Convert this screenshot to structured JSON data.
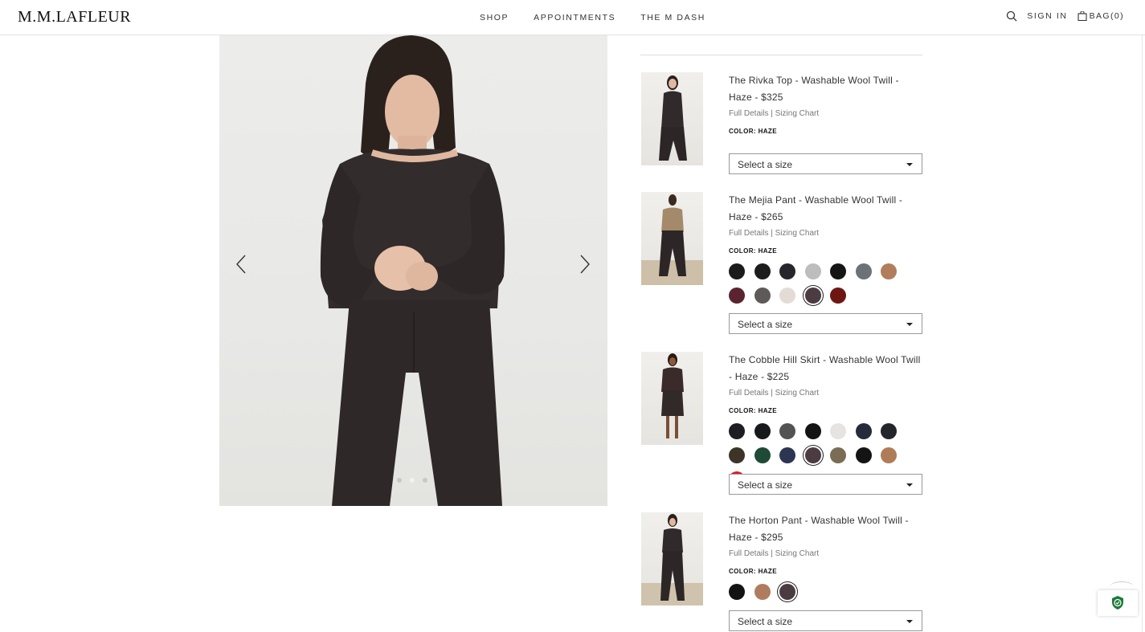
{
  "header": {
    "logo": "M.M.LAFLEUR",
    "nav": [
      "SHOP",
      "APPOINTMENTS",
      "THE M DASH"
    ],
    "sign_in": "SIGN IN",
    "bag": "BAG(0)"
  },
  "carousel": {
    "prev_icon": "chevron-left-icon",
    "next_icon": "chevron-right-icon",
    "total_slides": 3,
    "active_slide": 2
  },
  "products": [
    {
      "title": "The Rivka Top - Washable Wool Twill - Haze - $325",
      "link_full": "Full Details",
      "link_sep": "|",
      "link_sizing": "Sizing Chart",
      "color_label": "COLOR: HAZE",
      "swatches": [],
      "selected_swatch": -1,
      "size_placeholder": "Select a size"
    },
    {
      "title": "The Mejia Pant - Washable Wool Twill - Haze - $265",
      "link_full": "Full Details",
      "link_sep": "|",
      "link_sizing": "Sizing Chart",
      "color_label": "COLOR: HAZE",
      "swatches": [
        "#1b1b1d",
        "#1c1c1e",
        "#25272c",
        "#bdbdbf",
        "#151515",
        "#6e7179",
        "#b27d5b",
        "#5b2330",
        "#5e5a5a",
        "#e3dcd6",
        "#4a3c40",
        "#6e1712"
      ],
      "selected_swatch": 10,
      "size_placeholder": "Select a size"
    },
    {
      "title": "The Cobble Hill Skirt - Washable Wool Twill - Haze - $225",
      "link_full": "Full Details",
      "link_sep": "|",
      "link_sizing": "Sizing Chart",
      "color_label": "COLOR: HAZE",
      "swatches": [
        "#1d1e22",
        "#18191b",
        "#545353",
        "#141414",
        "#e6e4e2",
        "#262a3a",
        "#23252b",
        "#3b3427",
        "#1e4a37",
        "#2c3653",
        "#4a3c40",
        "#7a6c55",
        "#141414",
        "#b07c58",
        "#e01a2b"
      ],
      "selected_swatch": 10,
      "size_placeholder": "Select a size"
    },
    {
      "title": "The Horton Pant - Washable Wool Twill - Haze - $295",
      "link_full": "Full Details",
      "link_sep": "|",
      "link_sizing": "Sizing Chart",
      "color_label": "COLOR: HAZE",
      "swatches": [
        "#131313",
        "#b07c5f",
        "#4a3c40"
      ],
      "selected_swatch": 2,
      "size_placeholder": "Select a size"
    }
  ]
}
